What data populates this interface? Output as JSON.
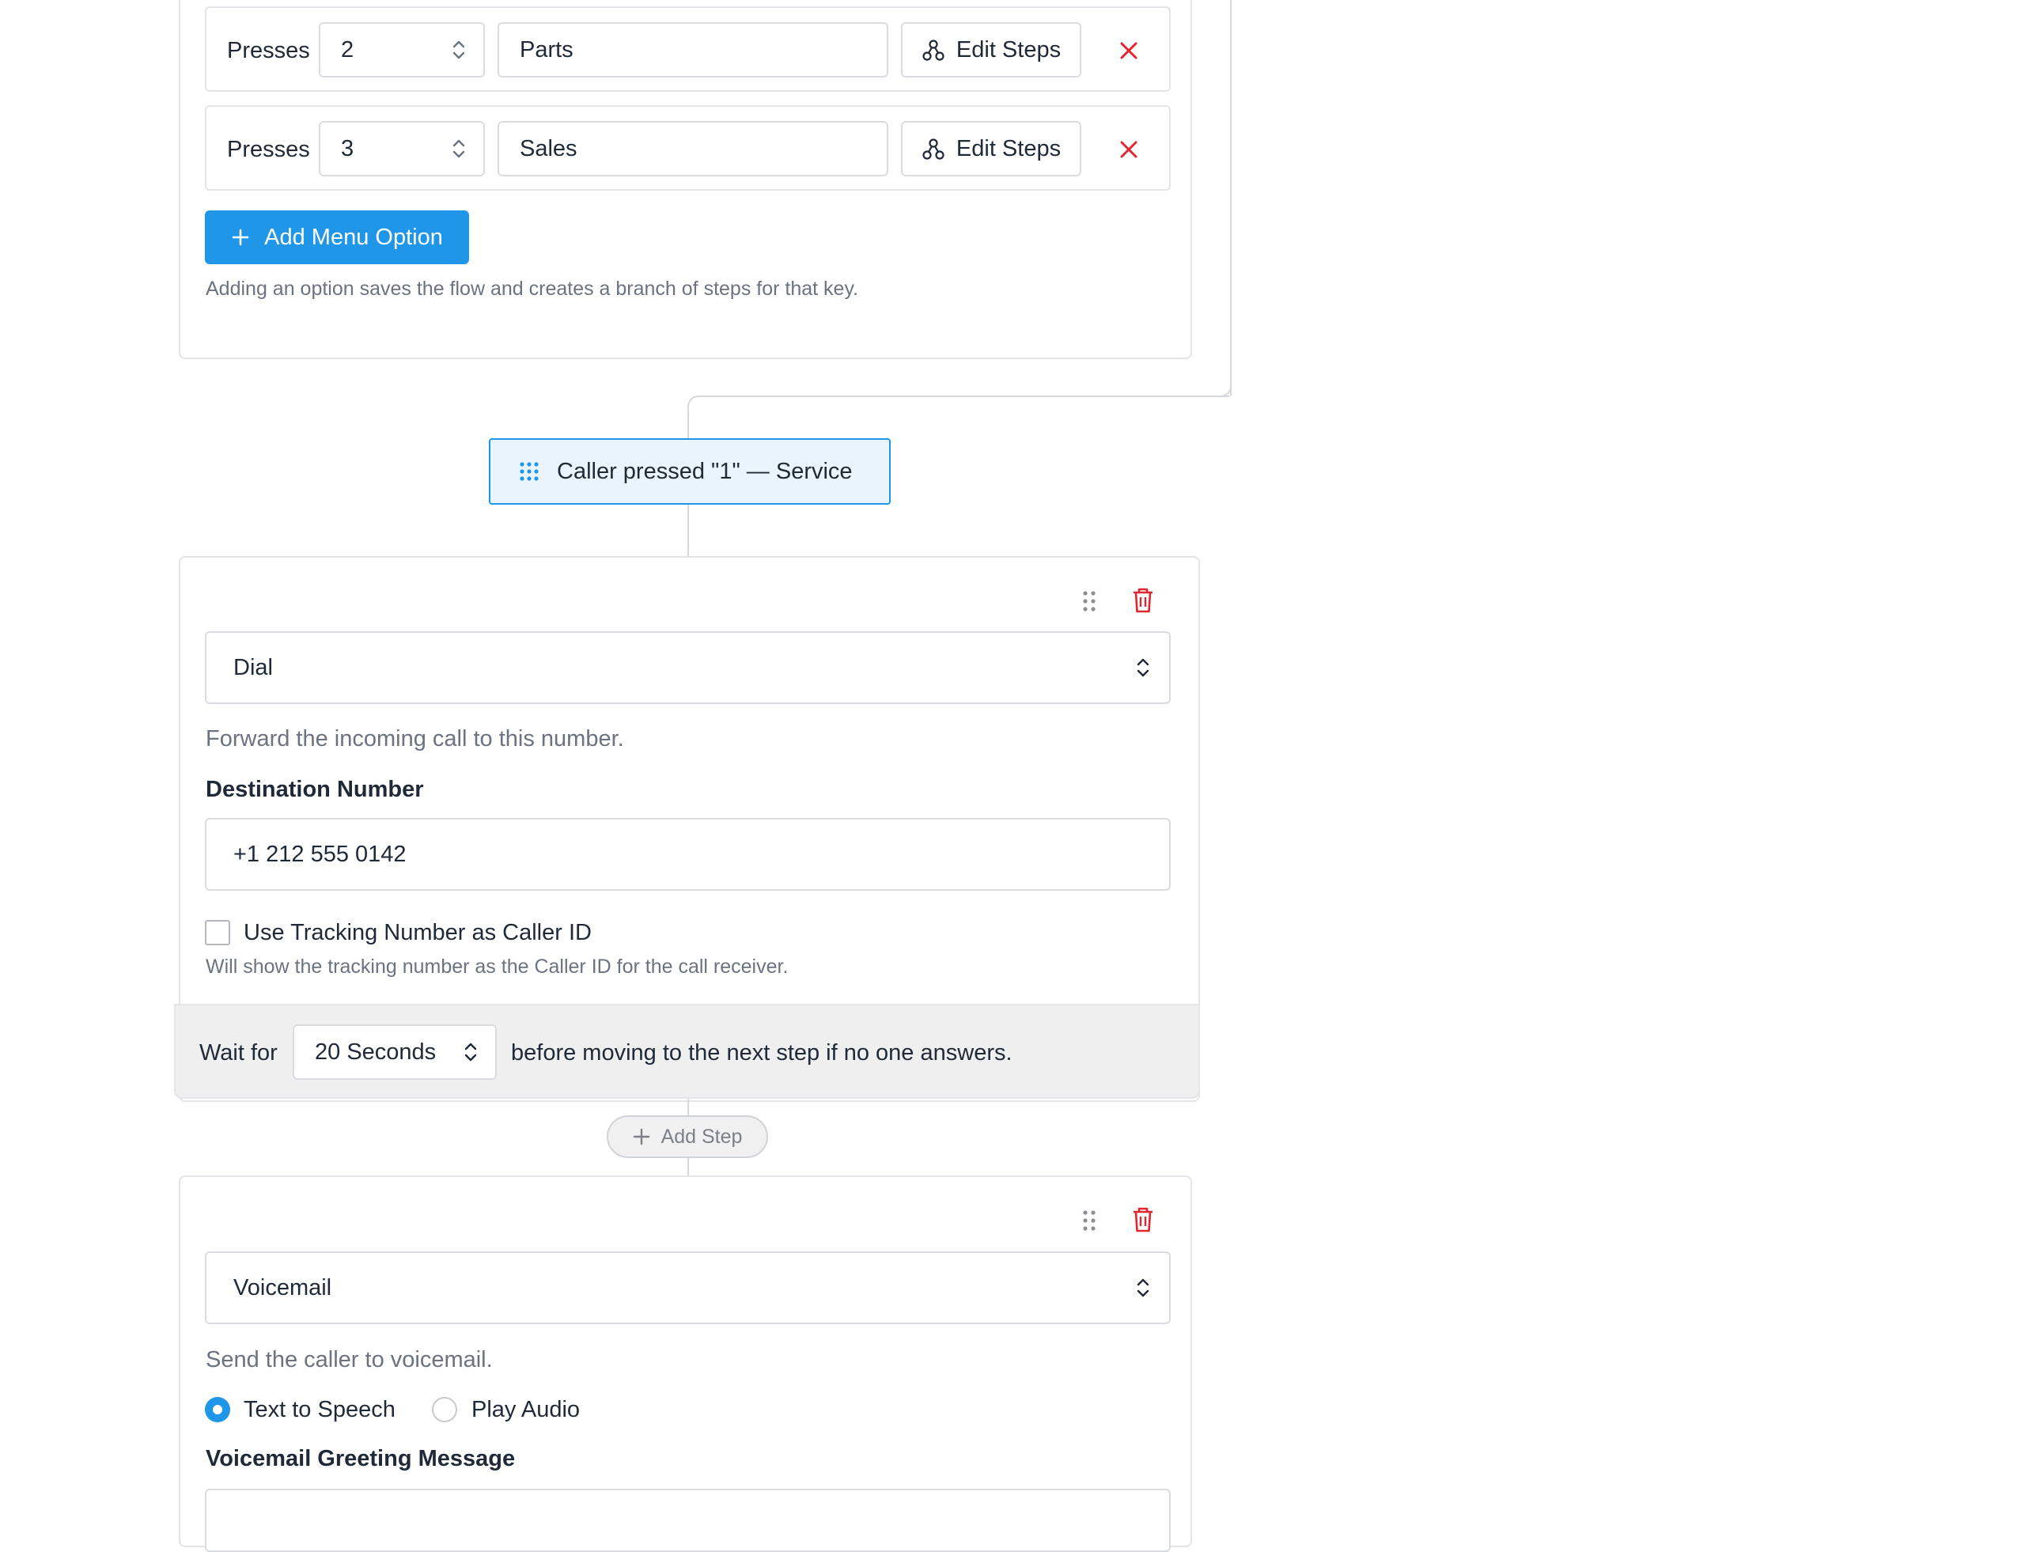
{
  "menu_options": [
    {
      "prefix": "Presses",
      "key": "2",
      "label": "Parts",
      "edit_label": "Edit Steps"
    },
    {
      "prefix": "Presses",
      "key": "3",
      "label": "Sales",
      "edit_label": "Edit Steps"
    }
  ],
  "add_menu_option_label": "Add Menu Option",
  "add_menu_option_hint": "Adding an option saves the flow and creates a branch of steps for that key.",
  "branch_label": "Caller pressed \"1\" — Service",
  "dial_step": {
    "type": "Dial",
    "description": "Forward the incoming call to this number.",
    "destination_label": "Destination Number",
    "destination_value": "+1 212 555 0142",
    "tracking_checkbox_label": "Use Tracking Number as Caller ID",
    "tracking_hint": "Will show the tracking number as the Caller ID for the call receiver.",
    "tracking_checked": false,
    "wait_prefix": "Wait for",
    "wait_value": "20 Seconds",
    "wait_suffix": "before moving to the next step if no one answers."
  },
  "add_step_label": "Add Step",
  "voicemail_step": {
    "type": "Voicemail",
    "description": "Send the caller to voicemail.",
    "radio_tts": "Text to Speech",
    "radio_audio": "Play Audio",
    "selected_mode": "Text to Speech",
    "greeting_label": "Voicemail Greeting Message"
  },
  "colors": {
    "accent": "#1f96e8",
    "danger": "#e0262f",
    "border": "#e3e5e8"
  }
}
